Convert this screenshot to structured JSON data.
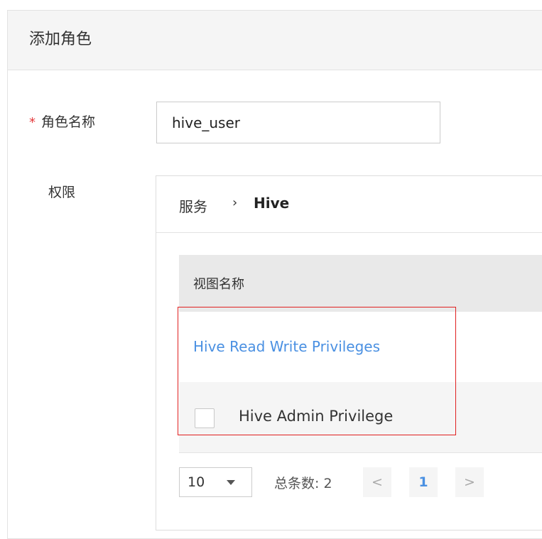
{
  "dialog": {
    "title": "添加角色"
  },
  "form": {
    "required_marker": "*",
    "role_name_label": "角色名称",
    "role_name_value": "hive_user",
    "permission_label": "权限"
  },
  "breadcrumb": {
    "service": "服务",
    "separator": "›",
    "current": "Hive"
  },
  "table": {
    "column_header": "视图名称",
    "rows": [
      {
        "label": "Hive Read Write Privileges",
        "type": "link"
      },
      {
        "label": "Hive Admin Privilege",
        "type": "checkbox",
        "checked": false
      }
    ]
  },
  "pagination": {
    "page_size": "10",
    "total_label": "总条数: 2",
    "prev_label": "<",
    "current_page": "1",
    "next_label": ">"
  },
  "colors": {
    "link": "#4a90e2",
    "required": "#e4393c",
    "highlight_border": "#e02020",
    "header_bg": "#f5f5f5",
    "table_header_bg": "#e9e9e9"
  }
}
